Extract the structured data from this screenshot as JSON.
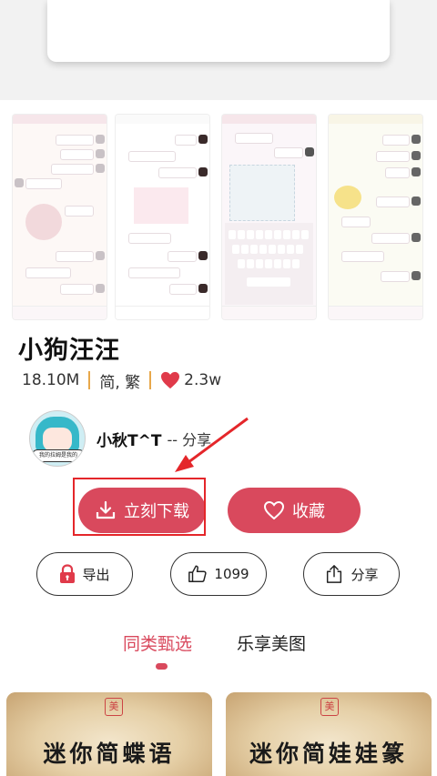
{
  "theme": {
    "accent": "#d9495d",
    "separator": "#e8a84b",
    "highlight": "#e4262a"
  },
  "item": {
    "title": "小狗汪汪",
    "size": "18.10M",
    "language": "简, 繁",
    "likes": "2.3w"
  },
  "author": {
    "name": "小秋T^T",
    "share_suffix": "-- 分享",
    "avatar_tag": "我的拉姆是我的"
  },
  "actions": {
    "download_label": "立刻下载",
    "favorite_label": "收藏",
    "export_label": "导出",
    "like_count": "1099",
    "share_label": "分享"
  },
  "tabs": [
    {
      "label": "同类甄选",
      "active": true
    },
    {
      "label": "乐享美图",
      "active": false
    }
  ],
  "related": [
    {
      "seal": "美",
      "title": "迷你简蝶语"
    },
    {
      "seal": "美",
      "title": "迷你简娃娃篆"
    }
  ],
  "icons": [
    "download-icon",
    "heart-outline-icon",
    "lock-icon",
    "thumb-up-icon",
    "share-icon",
    "heart-filled-icon"
  ]
}
